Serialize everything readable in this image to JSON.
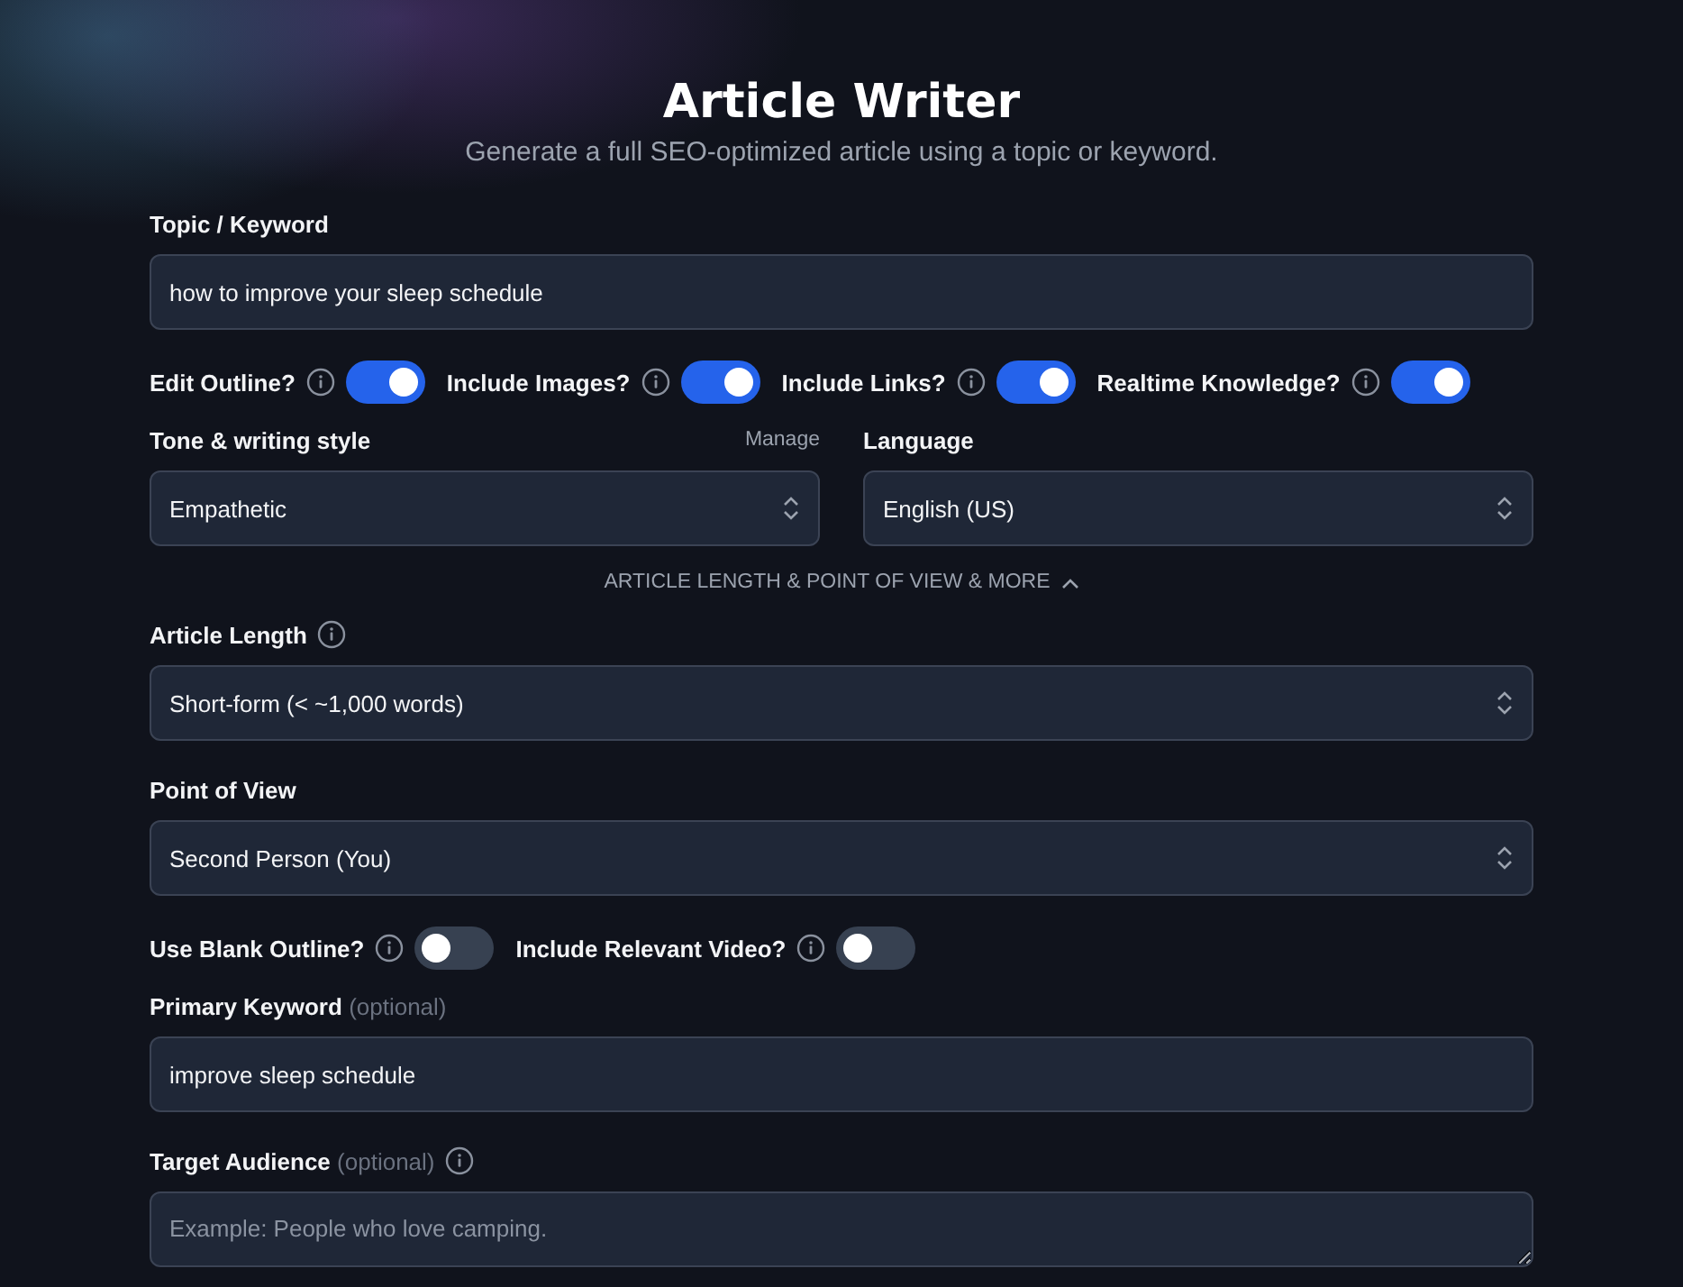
{
  "header": {
    "title": "Article Writer",
    "subtitle": "Generate a full SEO-optimized article using a topic or keyword."
  },
  "topic": {
    "label": "Topic / Keyword",
    "value": "how to improve your sleep schedule"
  },
  "toggles_1": [
    {
      "label": "Edit Outline?",
      "info": true,
      "on": true
    },
    {
      "label": "Include Images?",
      "info": true,
      "on": true
    },
    {
      "label": "Include Links?",
      "info": true,
      "on": true
    },
    {
      "label": "Realtime Knowledge?",
      "info": true,
      "on": true
    }
  ],
  "tone": {
    "label": "Tone & writing style",
    "manage": "Manage",
    "value": "Empathetic"
  },
  "language": {
    "label": "Language",
    "value": "English (US)"
  },
  "more_section": {
    "label": "ARTICLE LENGTH & POINT OF VIEW & MORE",
    "expanded": true
  },
  "article_length": {
    "label": "Article Length",
    "info": true,
    "value": "Short-form (< ~1,000 words)"
  },
  "point_of_view": {
    "label": "Point of View",
    "info": false,
    "value": "Second Person (You)"
  },
  "toggles_2": [
    {
      "label": "Use Blank Outline?",
      "info": true,
      "on": false
    },
    {
      "label": "Include Relevant Video?",
      "info": true,
      "on": false
    }
  ],
  "primary_keyword": {
    "label": "Primary Keyword",
    "optional": "(optional)",
    "info": false,
    "value": "improve sleep schedule"
  },
  "target_audience": {
    "label": "Target Audience",
    "optional": "(optional)",
    "info": true,
    "placeholder": "Example: People who love camping."
  }
}
